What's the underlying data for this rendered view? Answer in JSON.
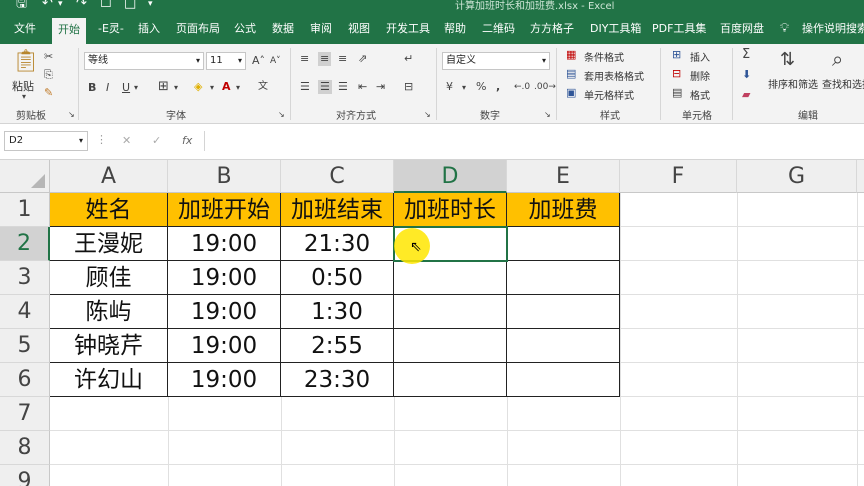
{
  "window": {
    "title": "计算加班时长和加班费.xlsx - Excel"
  },
  "ribbon_tabs": [
    "文件",
    "开始",
    "-E灵-",
    "插入",
    "页面布局",
    "公式",
    "数据",
    "审阅",
    "视图",
    "开发工具",
    "帮助",
    "二维码",
    "方方格子",
    "DIY工具箱",
    "PDF工具集",
    "百度网盘"
  ],
  "active_tab": "开始",
  "tell_me": "操作说明搜索",
  "clipboard": {
    "paste": "粘贴",
    "label": "剪贴板"
  },
  "font": {
    "name": "等线",
    "size": "11",
    "label": "字体"
  },
  "alignment": {
    "label": "对齐方式"
  },
  "number": {
    "format": "自定义",
    "label": "数字"
  },
  "styles": {
    "conditional": "条件格式",
    "table": "套用表格格式",
    "cell": "单元格样式",
    "label": "样式"
  },
  "cells": {
    "insert": "插入",
    "delete": "删除",
    "format": "格式",
    "label": "单元格"
  },
  "editing": {
    "sort": "排序和筛选",
    "find": "查找和选择",
    "label": "编辑"
  },
  "formula_bar": {
    "name_box": "D2",
    "fx": "fx",
    "formula": ""
  },
  "columns": [
    "A",
    "B",
    "C",
    "D",
    "E",
    "F",
    "G"
  ],
  "rows": [
    "1",
    "2",
    "3",
    "4",
    "5",
    "6",
    "7",
    "8",
    "9"
  ],
  "table": {
    "headers": [
      "姓名",
      "加班开始",
      "加班结束",
      "加班时长",
      "加班费"
    ],
    "data": [
      [
        "王漫妮",
        "19:00",
        "21:30",
        "",
        ""
      ],
      [
        "顾佳",
        "19:00",
        "0:50",
        "",
        ""
      ],
      [
        "陈屿",
        "19:00",
        "1:30",
        "",
        ""
      ],
      [
        "钟晓芹",
        "19:00",
        "2:55",
        "",
        ""
      ],
      [
        "许幻山",
        "19:00",
        "23:30",
        "",
        ""
      ]
    ]
  },
  "colors": {
    "excel_green": "#217346",
    "header_fill": "#ffc000"
  }
}
